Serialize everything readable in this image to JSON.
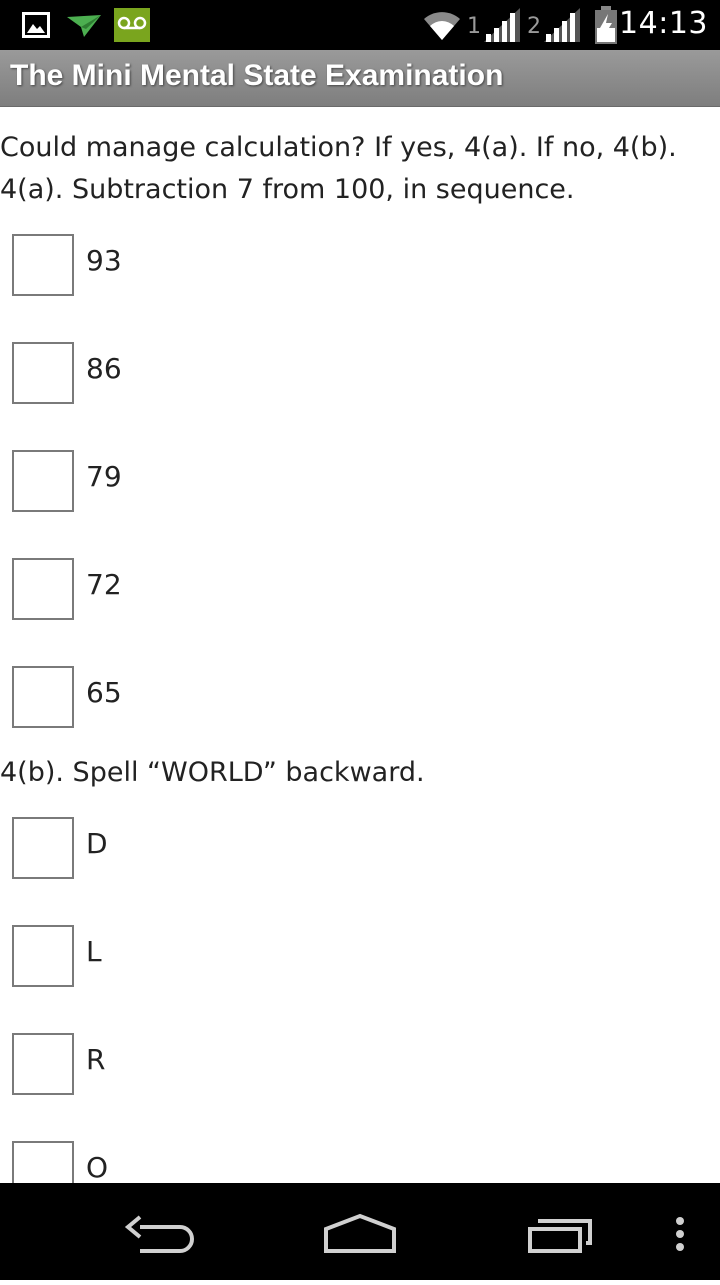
{
  "status_bar": {
    "time": "14:13",
    "sim1_label": "1",
    "sim2_label": "2",
    "icons": [
      "gallery-icon",
      "send-icon",
      "voicemail-icon",
      "wifi-icon",
      "signal-icon",
      "signal-icon",
      "battery-charging-icon"
    ]
  },
  "app": {
    "title": "The Mini Mental State Examination"
  },
  "question_a": {
    "line1": "Could manage calculation? If yes, 4(a). If no, 4(b).",
    "line2": "4(a). Subtraction 7 from 100, in sequence.",
    "options": [
      "93",
      "86",
      "79",
      "72",
      "65"
    ]
  },
  "question_b": {
    "text": "4(b). Spell “WORLD” backward.",
    "options": [
      "D",
      "L",
      "R",
      "O"
    ]
  },
  "nav_bar": {
    "buttons": [
      "back-icon",
      "home-icon",
      "recent-apps-icon",
      "overflow-menu-icon"
    ]
  },
  "colors": {
    "status_bar": "#000000",
    "title_bar": "#8c8c8c",
    "voicemail_badge": "#7aa51e"
  }
}
